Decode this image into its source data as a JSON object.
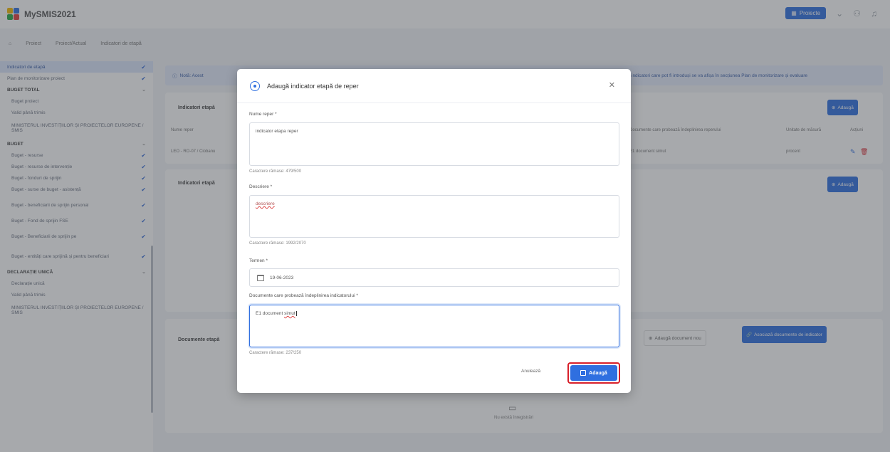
{
  "app": {
    "title": "MySMIS2021"
  },
  "topbar": {
    "primary_button": "Proiecte"
  },
  "breadcrumb": [
    "Proiect",
    "Proiect/Actual",
    "Indicatori de etapă"
  ],
  "sidebar": {
    "items": [
      {
        "label": "Indicatori de etapă",
        "active": true
      },
      {
        "label": "Plan de monitorizare proiect"
      },
      {
        "label": "BUGET TOTAL",
        "section": true
      },
      {
        "label": "Buget proiect"
      },
      {
        "label": "Valid până trimis"
      },
      {
        "label": "MINISTERUL INVESTIȚIILOR ȘI PROIECTELOR EUROPENE / SMIS"
      },
      {
        "label": "BUGET",
        "section": true
      },
      {
        "label": "Buget - resurse"
      },
      {
        "label": "Buget - resurse de intervenție"
      },
      {
        "label": "Buget - fonduri de sprijin"
      },
      {
        "label": "Buget - surse de buget - asistență"
      },
      {
        "label": "Buget - beneficiarii de sprijin personal"
      },
      {
        "label": "Buget - Fond de sprijin FSE"
      },
      {
        "label": "Buget - Beneficiarii de sprijin pe"
      },
      {
        "label": "Buget - entități care sprijină și pentru beneficiari"
      },
      {
        "label": "DECLARAȚIE UNICĂ",
        "section": true
      },
      {
        "label": "Declarație unică"
      },
      {
        "label": "Valid până trimis"
      },
      {
        "label": "MINISTERUL INVESTIȚIILOR ȘI PROIECTELOR EUROPENE / SMIS"
      }
    ]
  },
  "main": {
    "banner_left": "Notă: Acest",
    "banner_right": "indicatori care pot fi introduși se va afișa în secțiunea Plan de monitorizare și evaluare",
    "section1_title": "Indicatori etapă",
    "section2_title": "Indicatori etapă",
    "table_headers": [
      "Nume reper",
      "Documente care probează îndeplinirea reperului",
      "Unitate de măsură",
      "Acțiuni"
    ],
    "table_row": [
      "LEO - RO-07 / Ciobanu",
      "E1 document simut",
      "procent"
    ],
    "add_label": "Adaugă",
    "documents_title": "Documente etapă",
    "add_doc_label": "Adaugă document nou",
    "attach_doc_label": "Asociază documente de indicator",
    "no_records": "Nu există înregistrări"
  },
  "modal": {
    "title": "Adaugă indicator etapă de reper",
    "field1": {
      "label": "Nume reper *",
      "value": "indicator etapa reper",
      "remaining": "Caractere rămase: 479/500"
    },
    "field2": {
      "label": "Descriere *",
      "value": "descriere",
      "remaining": "Caractere rămase: 1992/2070"
    },
    "field3": {
      "label": "Termen *",
      "value": "19-06-2023"
    },
    "field4": {
      "label": "Documente care probează îndeplinirea indicatorului *",
      "value_prefix": "E1 document ",
      "value_flag": "simut",
      "remaining": "Caractere rămase: 237/250"
    },
    "cancel": "Anulează",
    "submit": "Adaugă"
  },
  "colors": {
    "accent": "#2f6fe0",
    "highlight_border": "#d8202a"
  }
}
